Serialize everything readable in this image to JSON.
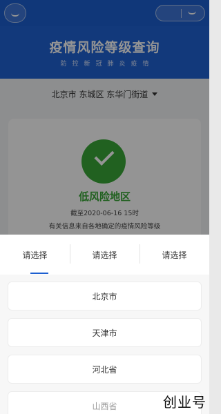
{
  "colors": {
    "brand_blue": "#1d5fd0",
    "low_risk_green": "#3aa838",
    "tab_active_underline": "#1d5fd0"
  },
  "topbar": {
    "back_icon": "back-icon",
    "capsule_icon": "capsule-close-icon"
  },
  "hero": {
    "title": "疫情风险等级查询",
    "subtitle": "防控新冠肺炎疫情"
  },
  "region": {
    "selected": "北京市 东城区 东华门街道"
  },
  "result": {
    "risk_level": "低风险地区",
    "as_of": "截至2020-06-16 15时",
    "note": "有关信息来自各地确定的疫情风险等级"
  },
  "picker": {
    "tabs": [
      {
        "label": "请选择",
        "active": true
      },
      {
        "label": "请选择",
        "active": false
      },
      {
        "label": "请选择",
        "active": false
      }
    ],
    "options": [
      "北京市",
      "天津市",
      "河北省",
      "山西省"
    ]
  },
  "watermark": "创业号"
}
